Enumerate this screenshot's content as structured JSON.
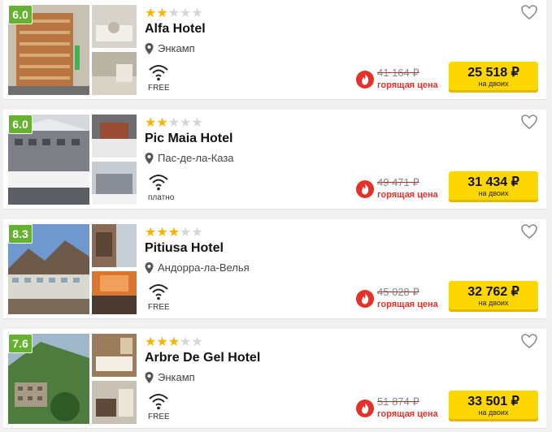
{
  "hotels": [
    {
      "rating": "6.0",
      "stars": 2,
      "name": "Alfa Hotel",
      "location": "Энкамп",
      "wifi": "FREE",
      "old_price": "41 164 ₽",
      "hot_label": "горящая цена",
      "price": "25 518 ₽",
      "price_note": "на двоих",
      "colors": {
        "main": "#b9753f",
        "side1": "#d7d3ca",
        "side2": "#b9b3a4"
      }
    },
    {
      "rating": "6.0",
      "stars": 2,
      "name": "Pic Maia Hotel",
      "location": "Пас-де-ла-Каза",
      "wifi": "платно",
      "old_price": "49 471 ₽",
      "hot_label": "горящая цена",
      "price": "31 434 ₽",
      "price_note": "на двоих",
      "colors": {
        "main": "#8d8f94",
        "side1": "#6e6e72",
        "side2": "#8a8e96"
      }
    },
    {
      "rating": "8.3",
      "stars": 3,
      "name": "Pitiusa Hotel",
      "location": "Андорра-ла-Велья",
      "wifi": "FREE",
      "old_price": "45 028 ₽",
      "hot_label": "горящая цена",
      "price": "32 762 ₽",
      "price_note": "на двоих",
      "colors": {
        "main": "#5a7fb0",
        "side1": "#8a6a55",
        "side2": "#d9772f"
      }
    },
    {
      "rating": "7.6",
      "stars": 3,
      "name": "Arbre De Gel Hotel",
      "location": "Энкамп",
      "wifi": "FREE",
      "old_price": "51 874 ₽",
      "hot_label": "горящая цена",
      "price": "33 501 ₽",
      "price_note": "на двоих",
      "colors": {
        "main": "#4d7c3e",
        "side1": "#9b7d5e",
        "side2": "#c9c1b3"
      }
    }
  ],
  "icons": {
    "wifi": "wifi-icon",
    "pin": "location-pin-icon",
    "heart": "heart-icon",
    "fire": "fire-icon",
    "star": "star-icon"
  },
  "accent": {
    "button": "#ffd700",
    "rating": "#64b22f",
    "hot": "#e4322b",
    "star": "#f4b400"
  }
}
